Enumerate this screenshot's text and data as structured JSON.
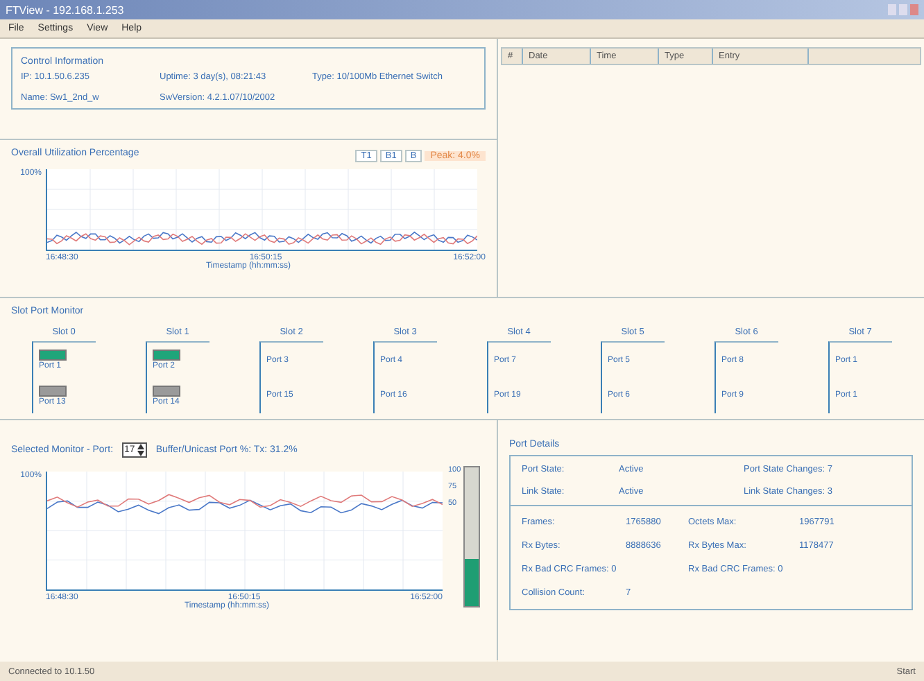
{
  "window": {
    "title": "FTView - 192.168.1.253"
  },
  "menu": [
    "File",
    "Settings",
    "View",
    "Help"
  ],
  "control_info": {
    "title": "Control Information",
    "fields": [
      "IP: 10.1.50.6.235",
      "Uptime: 3 day(s), 08:21:43",
      "Type: 10/100Mb Ethernet Switch",
      "Name: Sw1_2nd_w",
      "SwVersion: 4.2.1.07/10/2002"
    ]
  },
  "event_table": {
    "columns": [
      "#",
      "Date",
      "Time",
      "Type",
      "Entry"
    ]
  },
  "overall_chart": {
    "title": "Overall Utilization Percentage",
    "buttons": [
      "T1",
      "B1",
      "B"
    ],
    "peak": "Peak: 4.0%",
    "ylabel": "100%",
    "xticks": [
      "16:48:30",
      "16:50:15",
      "16:52:00"
    ],
    "xlabel": "Timestamp (hh:mm:ss)"
  },
  "slot_monitor": {
    "title": "Slot Port Monitor",
    "slots": [
      {
        "label": "Slot 0",
        "ports": [
          {
            "label": "Port 1",
            "color": "#1fa57a"
          },
          {
            "label": "Port 13",
            "color": "#9a9a9a"
          }
        ]
      },
      {
        "label": "Slot 1",
        "ports": [
          {
            "label": "Port 2",
            "color": "#1fa57a"
          },
          {
            "label": "Port 14",
            "color": "#9a9a9a"
          }
        ]
      },
      {
        "label": "Slot 2",
        "ports": [
          {
            "label": "Port 3"
          },
          {
            "label": "Port 15"
          }
        ]
      },
      {
        "label": "Slot 3",
        "ports": [
          {
            "label": "Port 4"
          },
          {
            "label": "Port 16"
          }
        ]
      },
      {
        "label": "Slot 4",
        "ports": [
          {
            "label": "Port 7"
          },
          {
            "label": "Port 19"
          }
        ]
      },
      {
        "label": "Slot 5",
        "ports": [
          {
            "label": "Port 5"
          },
          {
            "label": "Port 6"
          }
        ]
      },
      {
        "label": "Slot 6",
        "ports": [
          {
            "label": "Port 8"
          },
          {
            "label": "Port 9"
          }
        ]
      },
      {
        "label": "Slot 7",
        "ports": [
          {
            "label": "Port 1"
          },
          {
            "label": "Port 1"
          }
        ]
      }
    ]
  },
  "port_chart": {
    "title": "Selected Monitor - Port:",
    "port": "17",
    "reading": "Buffer/Unicast Port %: Tx: 31.2%",
    "ylabel": "100%",
    "xticks": [
      "16:48:30",
      "16:50:15",
      "16:52:00"
    ],
    "xlabel": "Timestamp (hh:mm:ss)",
    "meter_ticks": [
      "100",
      "75",
      "50"
    ],
    "meter": {
      "level": 0.34
    }
  },
  "port_details": {
    "title": "Port Details",
    "state_rows": [
      [
        "Port State:",
        "Active",
        "Port State Changes: 7"
      ],
      [
        "Link State:",
        "Active",
        "Link State Changes: 3"
      ]
    ],
    "counter_rows": [
      [
        "Frames:",
        "1765880",
        "Octets Max:",
        "1967791"
      ],
      [
        "Rx Bytes:",
        "8888636",
        "Rx Bytes Max:",
        "1178477"
      ],
      [
        "Rx Bad CRC Frames: 0",
        "",
        "Rx Bad CRC Frames: 0",
        ""
      ],
      [
        "Collision Count:",
        "7",
        "",
        ""
      ]
    ]
  },
  "status_bar": {
    "left": "Connected to 10.1.50",
    "right": "Start"
  }
}
